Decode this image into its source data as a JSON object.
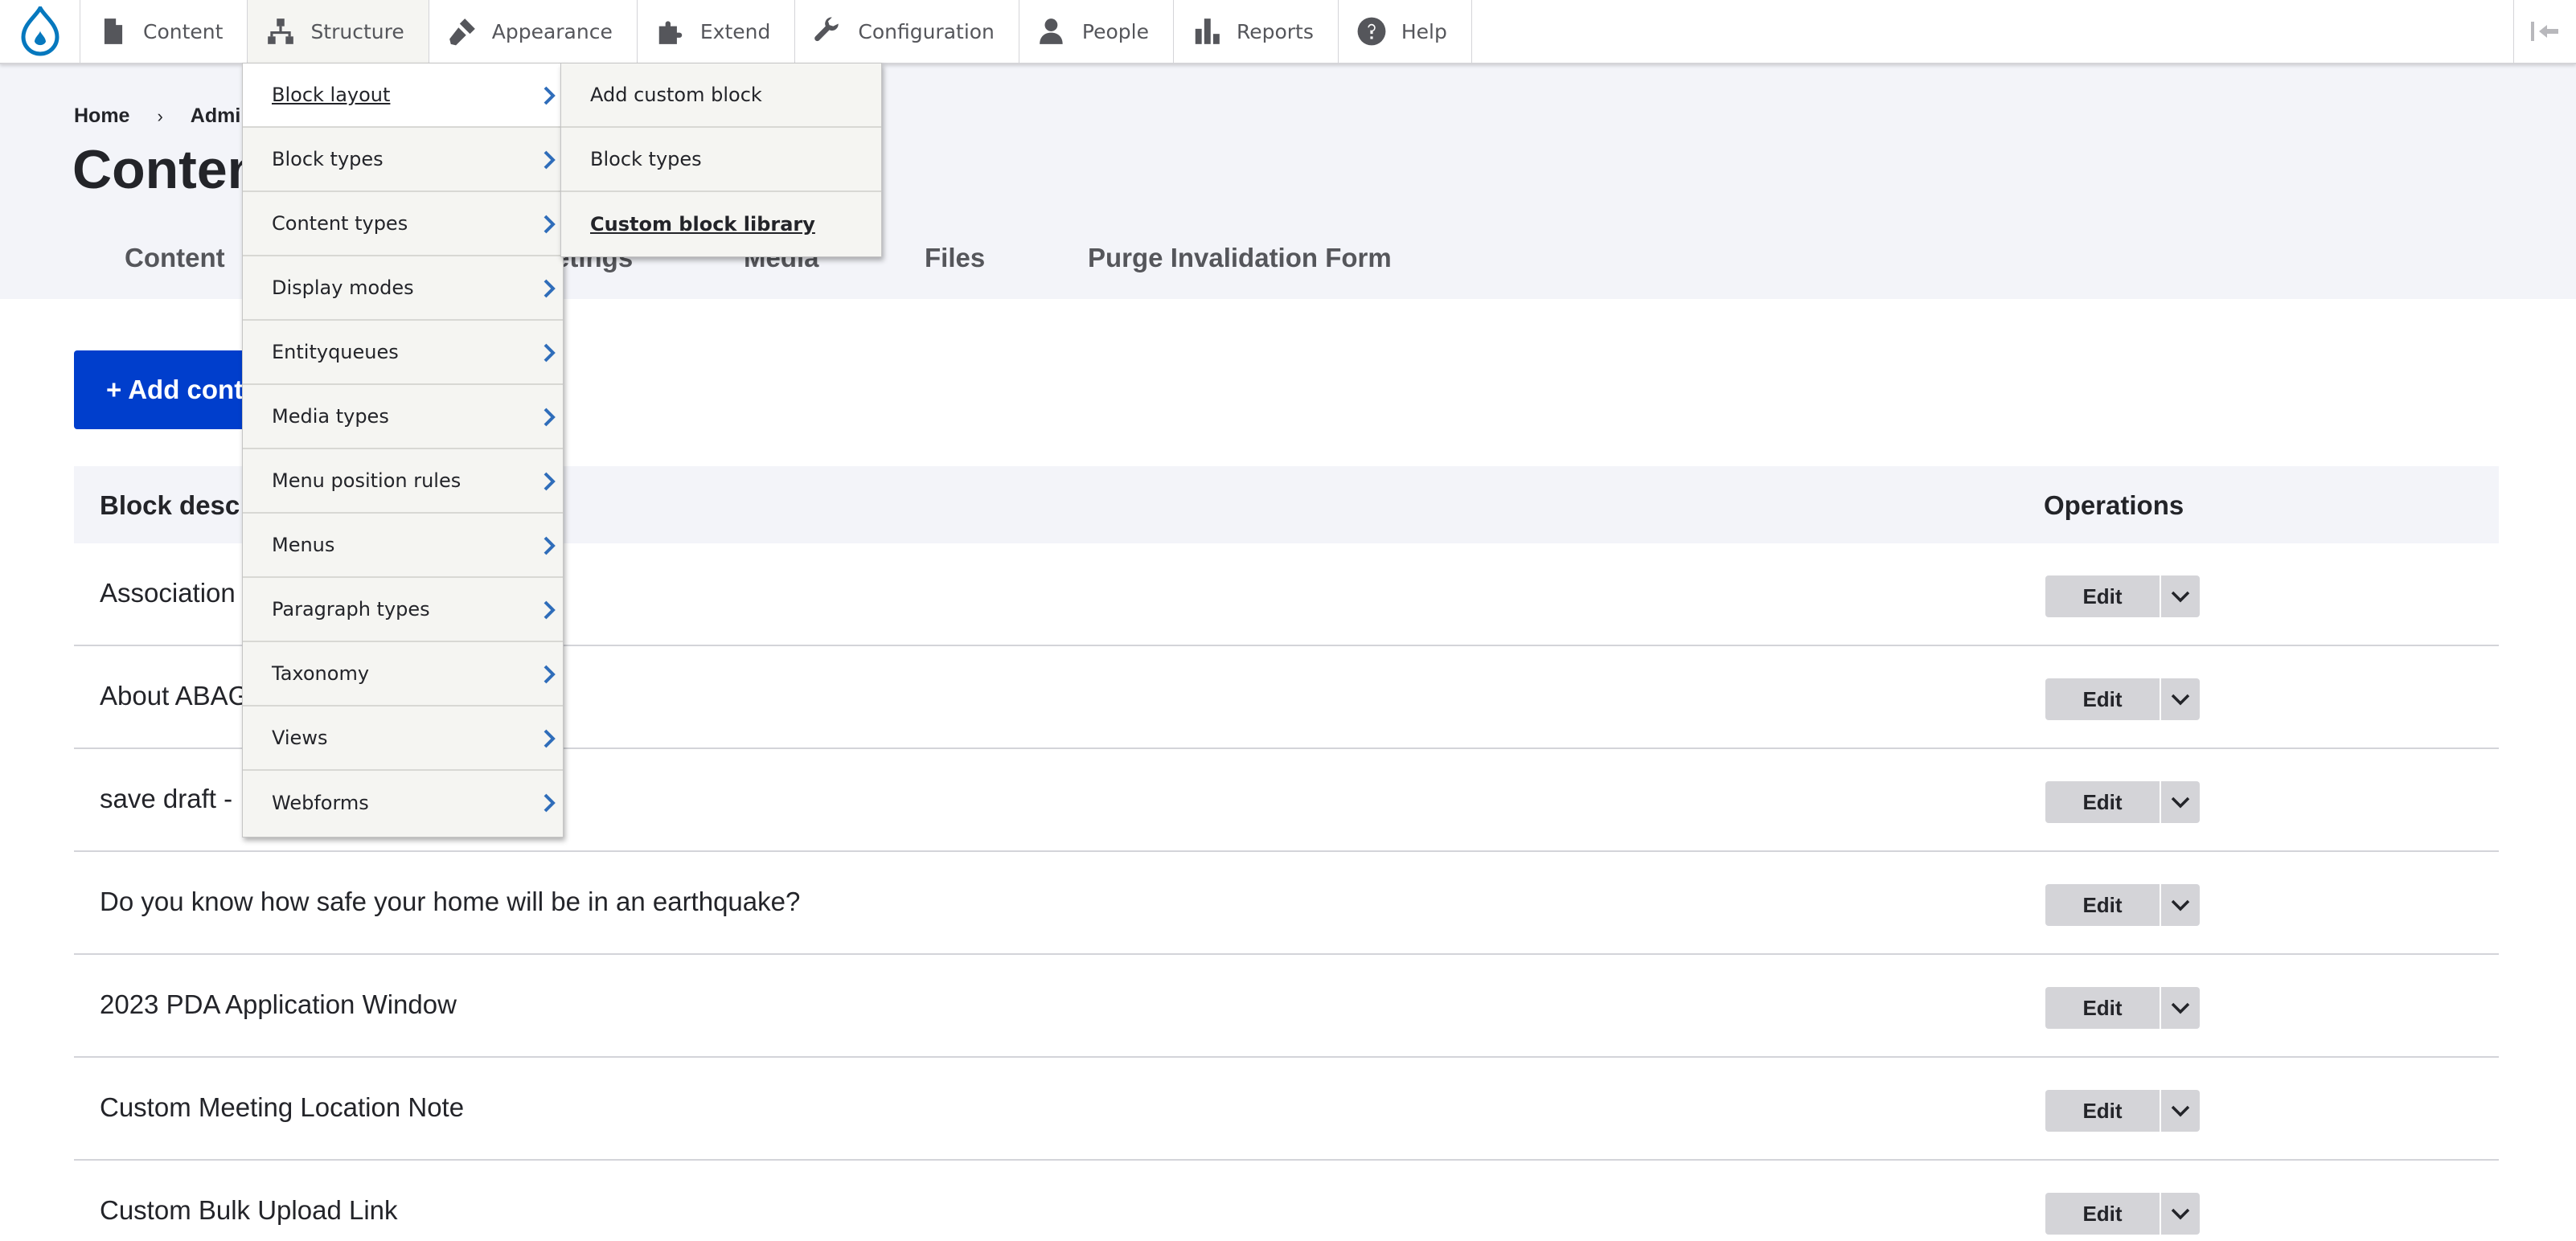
{
  "toolbar": {
    "items": [
      {
        "label": "Content",
        "icon": "file-icon"
      },
      {
        "label": "Structure",
        "icon": "sitemap-icon"
      },
      {
        "label": "Appearance",
        "icon": "paintbrush-icon"
      },
      {
        "label": "Extend",
        "icon": "puzzle-icon"
      },
      {
        "label": "Configuration",
        "icon": "wrench-icon"
      },
      {
        "label": "People",
        "icon": "person-icon"
      },
      {
        "label": "Reports",
        "icon": "bar-chart-icon"
      },
      {
        "label": "Help",
        "icon": "question-icon"
      }
    ],
    "accent": "#0678be"
  },
  "breadcrumb": [
    "Home",
    "Admi"
  ],
  "page_title": "Conten",
  "tabs": [
    "Content",
    "etings",
    "Media",
    "Files",
    "Purge Invalidation Form"
  ],
  "add_button": "+ Add cont",
  "table": {
    "headers": [
      "Block desc",
      "Operations"
    ],
    "rows": [
      "Association",
      "About ABAG",
      "save draft -",
      "Do you know how safe your home will be in an earthquake?",
      "2023 PDA Application Window",
      "Custom Meeting Location Note",
      "Custom Bulk Upload Link"
    ],
    "edit_label": "Edit"
  },
  "structure_menu": [
    "Block layout",
    "Block types",
    "Content types",
    "Display modes",
    "Entityqueues",
    "Media types",
    "Menu position rules",
    "Menus",
    "Paragraph types",
    "Taxonomy",
    "Views",
    "Webforms"
  ],
  "block_layout_submenu": [
    "Add custom block",
    "Block types",
    "Custom block library"
  ],
  "colors": {
    "primary_button": "#003ecc",
    "header_bg": "#f3f4f9",
    "menu_bg": "#f5f5f2",
    "chevron": "#2f6dba"
  }
}
